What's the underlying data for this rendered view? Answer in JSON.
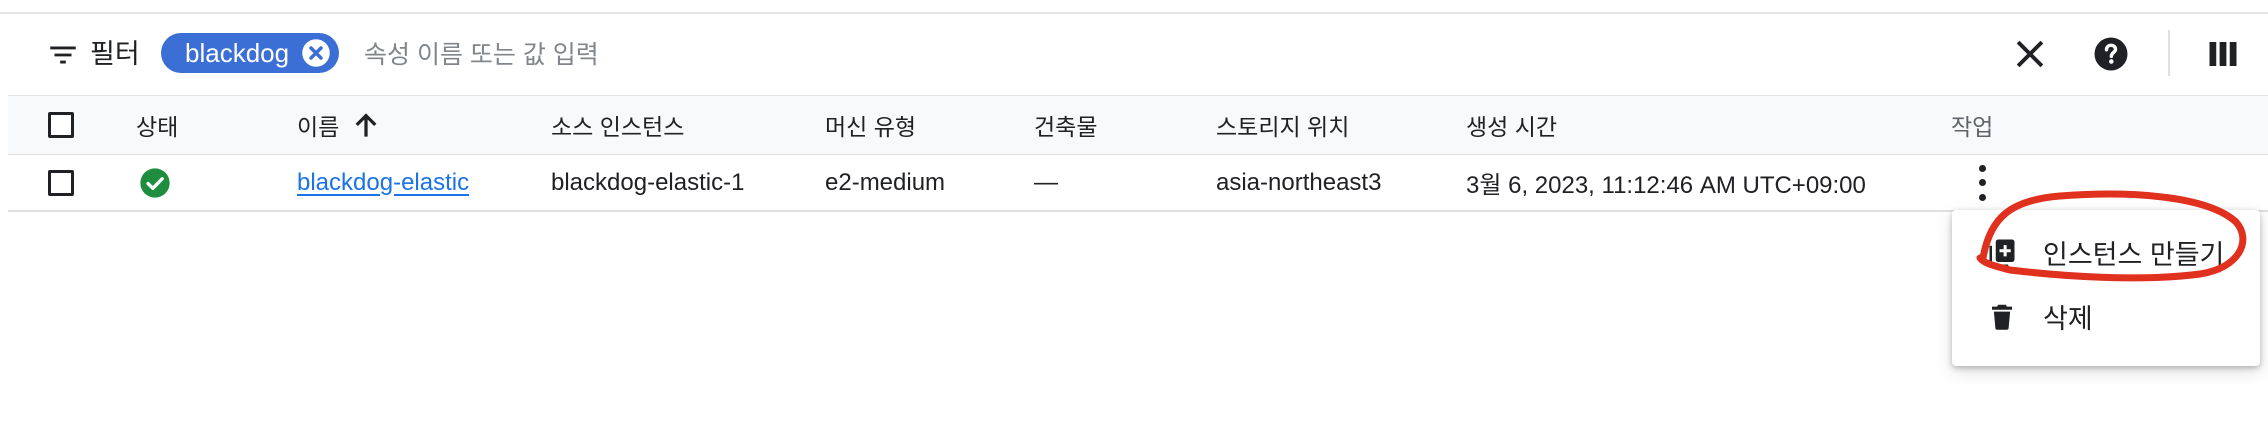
{
  "filter_bar": {
    "filter_label": "필터",
    "chip_label": "blackdog",
    "input_placeholder": "속성 이름 또는 값 입력",
    "input_value": ""
  },
  "table": {
    "headers": {
      "status": "상태",
      "name": "이름",
      "source_instance": "소스 인스턴스",
      "machine_type": "머신 유형",
      "artifact": "건축물",
      "storage_location": "스토리지 위치",
      "created_time": "생성 시간",
      "actions": "작업"
    },
    "sort": {
      "column": "name",
      "direction": "ascending"
    },
    "rows": [
      {
        "status": "ok",
        "name": "blackdog-elastic",
        "source_instance": "blackdog-elastic-1",
        "machine_type": "e2-medium",
        "artifact": "—",
        "storage_location": "asia-northeast3",
        "created_time": "3월 6, 2023, 11:12:46 AM UTC+09:00"
      }
    ]
  },
  "context_menu": {
    "items": [
      {
        "label": "인스턴스 만들기",
        "icon": "add-box-icon"
      },
      {
        "label": "삭제",
        "icon": "trash-icon"
      }
    ]
  },
  "colors": {
    "chip_bg": "#3b6fd6",
    "link": "#1a73e8",
    "status_ok": "#1e8e3e",
    "annotation_red": "#e0301e",
    "header_bg": "#f8f9fa"
  }
}
